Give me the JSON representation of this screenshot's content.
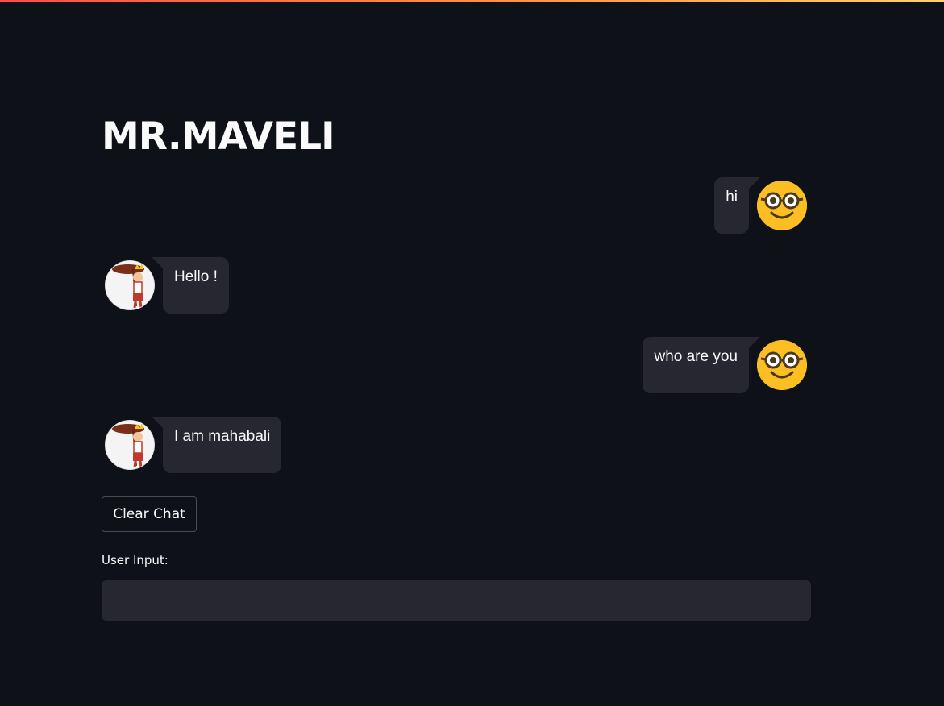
{
  "app": {
    "title": "MR.MAVELI"
  },
  "chat": {
    "messages": [
      {
        "role": "user",
        "text": "hi",
        "avatar": "nerd-face-emoji-icon"
      },
      {
        "role": "bot",
        "text": "Hello !",
        "avatar": "mahabali-cartoon-icon"
      },
      {
        "role": "user",
        "text": "who are you",
        "avatar": "nerd-face-emoji-icon"
      },
      {
        "role": "bot",
        "text": "I am mahabali",
        "avatar": "mahabali-cartoon-icon"
      }
    ]
  },
  "controls": {
    "clear_label": "Clear Chat",
    "input_label": "User Input:",
    "input_value": ""
  },
  "colors": {
    "background": "#0e1117",
    "bubble": "#262730",
    "text": "#fafafa",
    "user_avatar": "#fbbf24",
    "accent_gradient_start": "#ff4b4b",
    "accent_gradient_end": "#ffd166"
  }
}
